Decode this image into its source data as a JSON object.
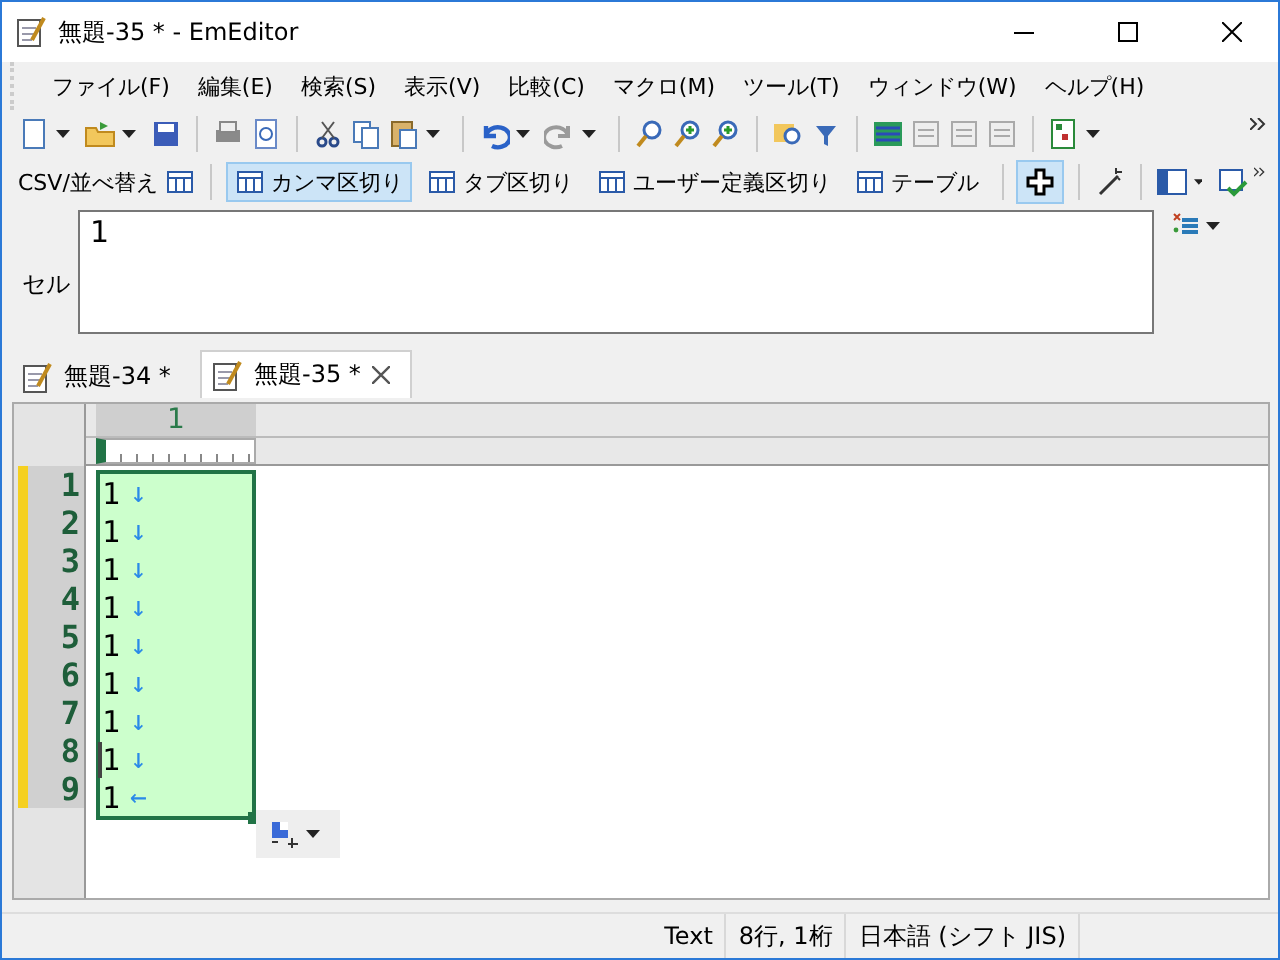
{
  "window": {
    "title": "無題-35 * - EmEditor"
  },
  "menu": [
    "ファイル(F)",
    "編集(E)",
    "検索(S)",
    "表示(V)",
    "比較(C)",
    "マクロ(M)",
    "ツール(T)",
    "ウィンドウ(W)",
    "ヘルプ(H)"
  ],
  "csv_toolbar": {
    "label": "CSV/並べ替え",
    "modes": [
      {
        "label": "カンマ区切り",
        "selected": true
      },
      {
        "label": "タブ区切り",
        "selected": false
      },
      {
        "label": "ユーザー定義区切り",
        "selected": false
      },
      {
        "label": "テーブル",
        "selected": false
      }
    ],
    "cell_cursor_selected": true
  },
  "cell_bar": {
    "label": "セル",
    "value": "1"
  },
  "tabs": [
    {
      "label": "無題-34 *",
      "selected": false
    },
    {
      "label": "無題-35 *",
      "selected": true
    }
  ],
  "editor": {
    "columns": [
      "1"
    ],
    "rows": [
      {
        "number": "1",
        "text": "1",
        "end": "↓",
        "current": false
      },
      {
        "number": "2",
        "text": "1",
        "end": "↓",
        "current": false
      },
      {
        "number": "3",
        "text": "1",
        "end": "↓",
        "current": false
      },
      {
        "number": "4",
        "text": "1",
        "end": "↓",
        "current": false
      },
      {
        "number": "5",
        "text": "1",
        "end": "↓",
        "current": false
      },
      {
        "number": "6",
        "text": "1",
        "end": "↓",
        "current": false
      },
      {
        "number": "7",
        "text": "1",
        "end": "↓",
        "current": false
      },
      {
        "number": "8",
        "text": "1",
        "end": "↓",
        "current": true
      },
      {
        "number": "9",
        "text": "1",
        "end": "←",
        "current": false
      }
    ]
  },
  "status_bar": [
    "Text",
    "8行, 1桁",
    "日本語 (シフト JIS)"
  ]
}
